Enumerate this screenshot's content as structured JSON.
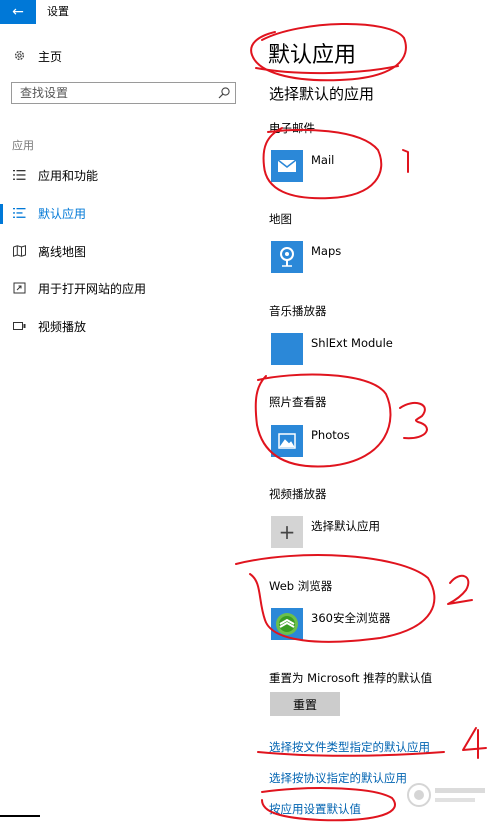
{
  "titlebar": {
    "back_icon": "←",
    "app_title": "设置"
  },
  "nav": {
    "home_label": "主页",
    "search_placeholder": "查找设置",
    "section_label": "应用",
    "items": [
      {
        "label": "应用和功能",
        "icon": "list-icon"
      },
      {
        "label": "默认应用",
        "icon": "default-apps-icon",
        "active": true
      },
      {
        "label": "离线地图",
        "icon": "offline-map-icon"
      },
      {
        "label": "用于打开网站的应用",
        "icon": "website-app-icon"
      },
      {
        "label": "视频播放",
        "icon": "video-playback-icon"
      }
    ]
  },
  "main": {
    "title": "默认应用",
    "subtitle": "选择默认的应用",
    "categories": [
      {
        "label": "电子邮件",
        "app": "Mail"
      },
      {
        "label": "地图",
        "app": "Maps"
      },
      {
        "label": "音乐播放器",
        "app": "ShlExt Module"
      },
      {
        "label": "照片查看器",
        "app": "Photos"
      },
      {
        "label": "视频播放器",
        "app": "选择默认应用"
      },
      {
        "label": "Web 浏览器",
        "app": "360安全浏览器"
      }
    ],
    "reset_label": "重置为 Microsoft 推荐的默认值",
    "reset_button": "重置",
    "links": [
      "选择按文件类型指定的默认应用",
      "选择按协议指定的默认应用",
      "按应用设置默认值"
    ]
  },
  "annotations": [
    "1",
    "2",
    "3",
    "4"
  ],
  "colors": {
    "accent": "#0078d7",
    "tile": "#2b88d8",
    "link": "#0063b1",
    "annotation": "#e0141e"
  }
}
